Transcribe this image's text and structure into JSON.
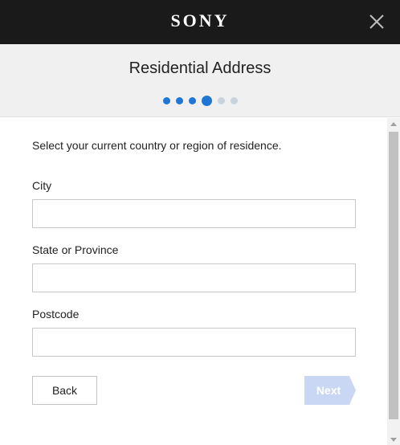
{
  "header": {
    "brand": "SONY",
    "title": "Residential Address",
    "steps": {
      "total": 6,
      "current": 4
    }
  },
  "form": {
    "intro": "Select your current country or region of residence.",
    "city": {
      "label": "City",
      "value": "",
      "placeholder": ""
    },
    "state": {
      "label": "State or Province",
      "value": "",
      "placeholder": ""
    },
    "postcode": {
      "label": "Postcode",
      "value": "",
      "placeholder": ""
    }
  },
  "actions": {
    "back_label": "Back",
    "next_label": "Next",
    "next_enabled": false
  },
  "colors": {
    "topbar": "#1a1a1a",
    "accent": "#1e77d4",
    "next_disabled": "#c9d6f4",
    "header_bg": "#f0f0f0"
  },
  "icons": {
    "close": "close-icon",
    "scroll_up": "scroll-up-arrow-icon",
    "scroll_down": "scroll-down-arrow-icon"
  }
}
